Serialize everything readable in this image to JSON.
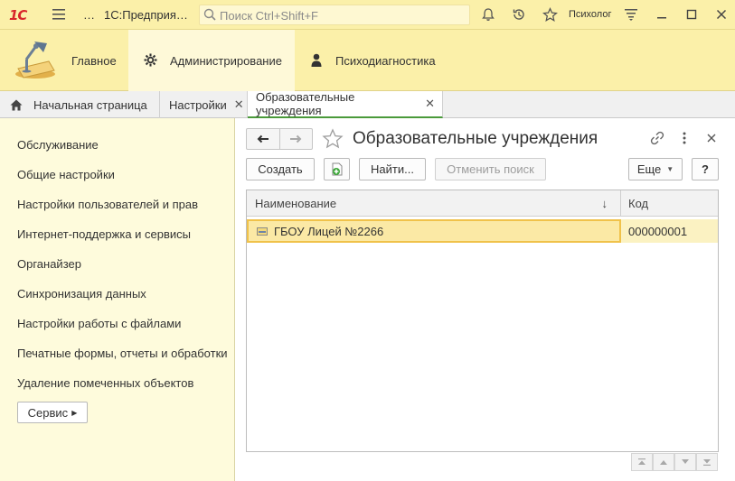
{
  "titlebar": {
    "logo": "1С",
    "ellipsis": "…",
    "app_title": "1С:Предприя…",
    "search_placeholder": "Поиск Ctrl+Shift+F",
    "user": "Психолог"
  },
  "sections": [
    {
      "label": "Главное"
    },
    {
      "label": "Администрирование"
    },
    {
      "label": "Психодиагностика"
    }
  ],
  "open_tabs": [
    {
      "label": "Начальная страница"
    },
    {
      "label": "Настройки"
    },
    {
      "label": "Образовательные учреждения"
    }
  ],
  "left_nav": {
    "items": [
      "Обслуживание",
      "Общие настройки",
      "Настройки пользователей и прав",
      "Интернет-поддержка и сервисы",
      "Органайзер",
      "Синхронизация данных",
      "Настройки работы с файлами",
      "Печатные формы, отчеты и обработки",
      "Удаление помеченных объектов"
    ],
    "service_button": "Сервис"
  },
  "form": {
    "title": "Образовательные учреждения",
    "buttons": {
      "create": "Создать",
      "find": "Найти...",
      "cancel_search": "Отменить поиск",
      "more": "Еще",
      "help": "?"
    },
    "table": {
      "columns": [
        "Наименование",
        "Код"
      ],
      "sort_indicator": "↓",
      "rows": [
        {
          "name": "ГБОУ Лицей №2266",
          "code": "000000001"
        }
      ]
    }
  },
  "colors": {
    "accent_yellow": "#fbf0a9",
    "selected_row": "#fbf2c2",
    "logo_red": "#d8262b",
    "active_tab_underline": "#4a9a3a"
  }
}
